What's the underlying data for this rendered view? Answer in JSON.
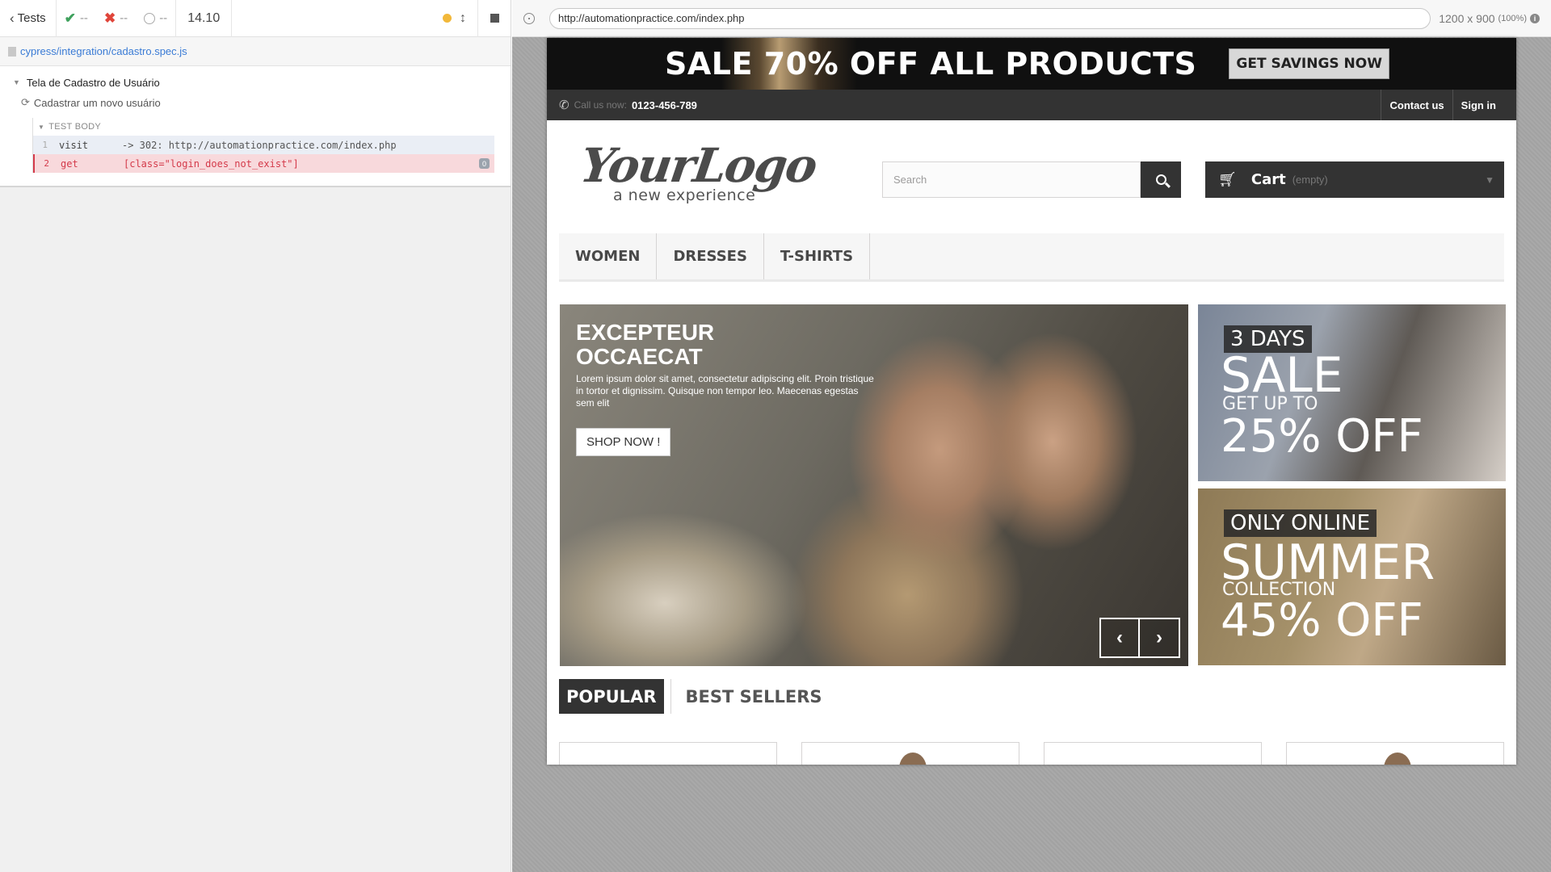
{
  "reporter": {
    "back_label": "Tests",
    "passed": "--",
    "failed": "--",
    "pending": "--",
    "duration": "14.10",
    "spec_path": "cypress/integration/cadastro.spec.js",
    "suite_title": "Tela de Cadastro de Usuário",
    "test_title": "Cadastrar um novo usuário",
    "test_body_label": "TEST BODY",
    "commands": [
      {
        "num": "1",
        "name": "visit",
        "message": "-> 302: http://automationpractice.com/index.php"
      },
      {
        "num": "2",
        "name": "get",
        "message": "[class=\"login_does_not_exist\"]",
        "badge": "0"
      }
    ]
  },
  "aut": {
    "url": "http://automationpractice.com/index.php",
    "viewport": "1200 x 900",
    "zoom": "(100%)"
  },
  "site": {
    "banner_text": "SALE 70% OFF ALL PRODUCTS",
    "banner_button": "GET SAVINGS NOW",
    "call_label": "Call us now:",
    "phone": "0123-456-789",
    "contact_link": "Contact us",
    "signin_link": "Sign in",
    "logo_text": "YourLogo",
    "logo_tagline": "a new experience",
    "search_placeholder": "Search",
    "cart_label": "Cart",
    "cart_status": "(empty)",
    "menu": [
      "Women",
      "Dresses",
      "T-shirts"
    ],
    "hero": {
      "title": "EXCEPTEUR OCCAECAT",
      "text": "Lorem ipsum dolor sit amet, consectetur adipiscing elit. Proin tristique in tortor et dignissim. Quisque non tempor leo. Maecenas egestas sem elit",
      "button": "SHOP NOW !"
    },
    "promo1": {
      "tag": "3 DAYS",
      "big": "SALE",
      "mid": "GET UP TO",
      "pct": "25% OFF"
    },
    "promo2": {
      "tag": "ONLY ONLINE",
      "big": "SUMMER",
      "mid": "COLLECTION",
      "pct": "45% OFF"
    },
    "tabs": [
      "POPULAR",
      "BEST SELLERS"
    ]
  },
  "colors": {
    "accent_dark": "#333333",
    "fail_red": "#d43a4a",
    "pass_green": "#3fa15d",
    "link_blue": "#3a7bd5"
  }
}
